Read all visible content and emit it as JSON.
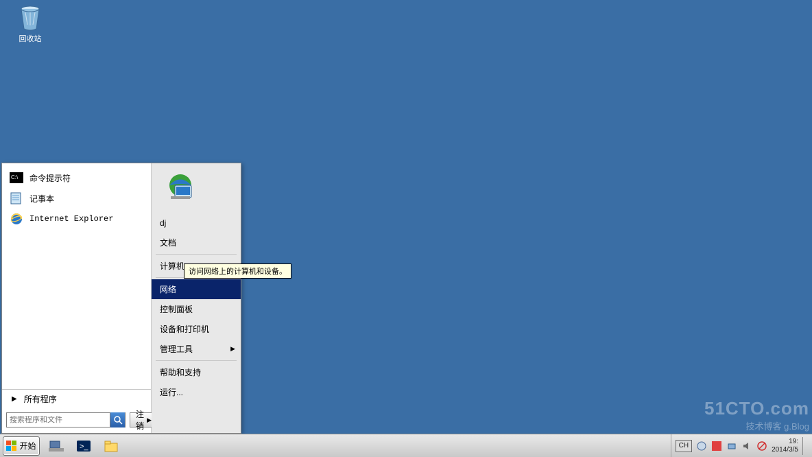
{
  "desktop": {
    "recycle_bin": "回收站"
  },
  "start_menu": {
    "programs": [
      {
        "icon": "cmd-icon",
        "label": "命令提示符"
      },
      {
        "icon": "notepad-icon",
        "label": "记事本"
      },
      {
        "icon": "ie-icon",
        "label": "Internet Explorer"
      }
    ],
    "all_programs": "所有程序",
    "search_placeholder": "搜索程序和文件",
    "logoff": "注销",
    "user": "dj",
    "right_items": [
      {
        "label": "dj",
        "sep_after": false
      },
      {
        "label": "文档",
        "sep_after": true
      },
      {
        "label": "计算机",
        "sep_after": true
      },
      {
        "label": "网络",
        "sep_after": false,
        "selected": true
      },
      {
        "label": "控制面板",
        "sep_after": false
      },
      {
        "label": "设备和打印机",
        "sep_after": false
      },
      {
        "label": "管理工具",
        "sep_after": true,
        "submenu": true
      },
      {
        "label": "帮助和支持",
        "sep_after": false
      },
      {
        "label": "运行...",
        "sep_after": false
      }
    ],
    "tooltip": "访问网络上的计算机和设备。"
  },
  "taskbar": {
    "start": "开始",
    "tray": {
      "lang": "CH",
      "time": "19:",
      "date": "2014/3/5"
    }
  },
  "watermark": {
    "l1": "51CTO.com",
    "l2": "技术博客 g.Blog"
  }
}
